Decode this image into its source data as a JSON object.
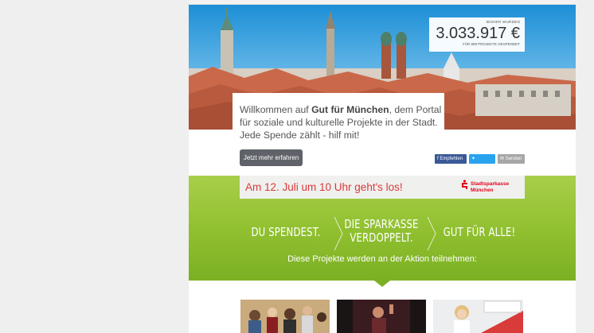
{
  "counter": {
    "label": "BISHER WURDEN",
    "amount": "3.033.917 €",
    "sub": "FÜR 899 PROJEKTE GESPENDET"
  },
  "welcome": {
    "pre": "Willkommen auf ",
    "brand": "Gut für München",
    "post": ", dem Portal für soziale und kulturelle Projekte in der Stadt. Jede Spende zählt - hilf mit!",
    "cta": "Jetzt mehr erfahren"
  },
  "social": {
    "facebook": "Empfehlen",
    "twitter": "Twittern",
    "send": "Senden"
  },
  "announcement": {
    "date_text": "Am 12. Juli um 10 Uhr geht's los!",
    "bank_line1": "Stadtsparkasse",
    "bank_line2": "München"
  },
  "slogans": {
    "one": "DU SPENDEST.",
    "two_line1": "DIE SPARKASSE",
    "two_line2": "VERDOPPELT.",
    "three": "GUT FÜR ALLE!"
  },
  "projects_line": "Diese Projekte werden an der Aktion teilnehmen:",
  "colors": {
    "green": "#8fbf2f",
    "announce_red": "#d63b3b",
    "sparkasse_red": "#e2001a",
    "facebook": "#3b5998",
    "twitter": "#2aa3ef"
  }
}
